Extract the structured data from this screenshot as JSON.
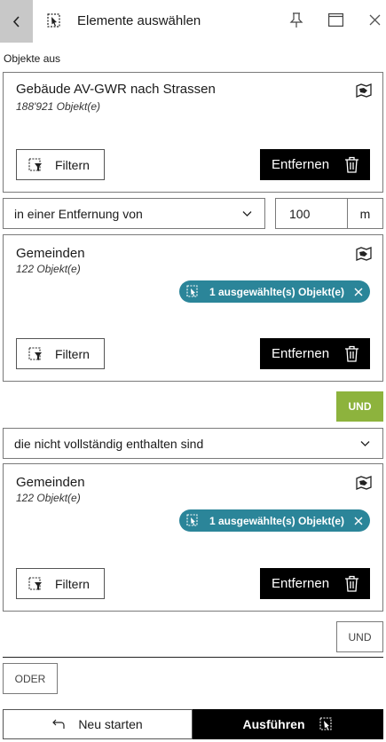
{
  "header": {
    "title": "Elemente auswählen",
    "back_icon": "chevron-left-icon",
    "tool_icon": "select-features-icon",
    "pin_icon": "pin-icon",
    "maximize_icon": "maximize-icon",
    "close_icon": "close-icon"
  },
  "section_label": "Objekte aus",
  "source_card": {
    "title": "Gebäude AV-GWR nach Strassen",
    "count": "188'921 Objekt(e)",
    "filter_label": "Filtern",
    "remove_label": "Entfernen"
  },
  "relation1": {
    "selected": "in einer Entfernung von",
    "distance_value": "100",
    "unit": "m"
  },
  "target_card_1": {
    "title": "Gemeinden",
    "count": "122 Objekt(e)",
    "chip_label": "1 ausgewählte(s) Objekt(e)",
    "filter_label": "Filtern",
    "remove_label": "Entfernen"
  },
  "und_active_label": "UND",
  "relation2": {
    "selected": "die nicht vollständig enthalten sind"
  },
  "target_card_2": {
    "title": "Gemeinden",
    "count": "122 Objekt(e)",
    "chip_label": "1 ausgewählte(s) Objekt(e)",
    "filter_label": "Filtern",
    "remove_label": "Entfernen"
  },
  "und_label": "UND",
  "oder_label": "ODER",
  "footer": {
    "restart_label": "Neu starten",
    "run_label": "Ausführen"
  },
  "colors": {
    "chip": "#2b8599",
    "und_active": "#8db33d",
    "primary_button": "#000000",
    "back_button": "#c8c8c8"
  }
}
